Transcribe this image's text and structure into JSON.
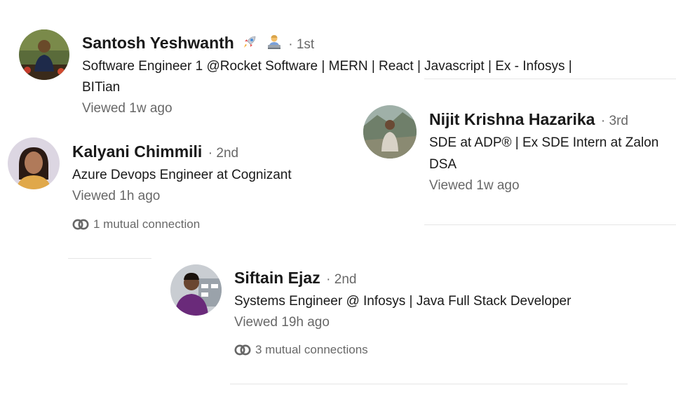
{
  "people": [
    {
      "name": "Santosh Yeshwanth",
      "emojis": [
        "rocket-icon",
        "technologist-icon"
      ],
      "degree": "· 1st",
      "headline_line1": "Software Engineer 1 @Rocket Software | MERN | React | Javascript | Ex - Infosys |",
      "headline_line2": "BITian",
      "viewed": "Viewed 1w ago"
    },
    {
      "name": "Nijit Krishna Hazarika",
      "degree": "· 3rd",
      "headline_line1": "SDE at ADP® | Ex SDE Intern at Zalon",
      "headline_line2": "DSA",
      "viewed": "Viewed 1w ago"
    },
    {
      "name": "Kalyani Chimmili",
      "degree": "· 2nd",
      "headline_line1": "Azure Devops Engineer at Cognizant",
      "viewed": "Viewed 1h ago",
      "mutual": "1 mutual connection"
    },
    {
      "name": "Siftain Ejaz",
      "degree": "· 2nd",
      "headline_line1": "Systems Engineer @ Infosys | Java Full Stack Developer",
      "viewed": "Viewed 19h ago",
      "mutual": "3 mutual connections"
    }
  ],
  "colors": {
    "primary_text": "#191919",
    "secondary_text": "#666666",
    "divider": "#e6e6e6"
  }
}
